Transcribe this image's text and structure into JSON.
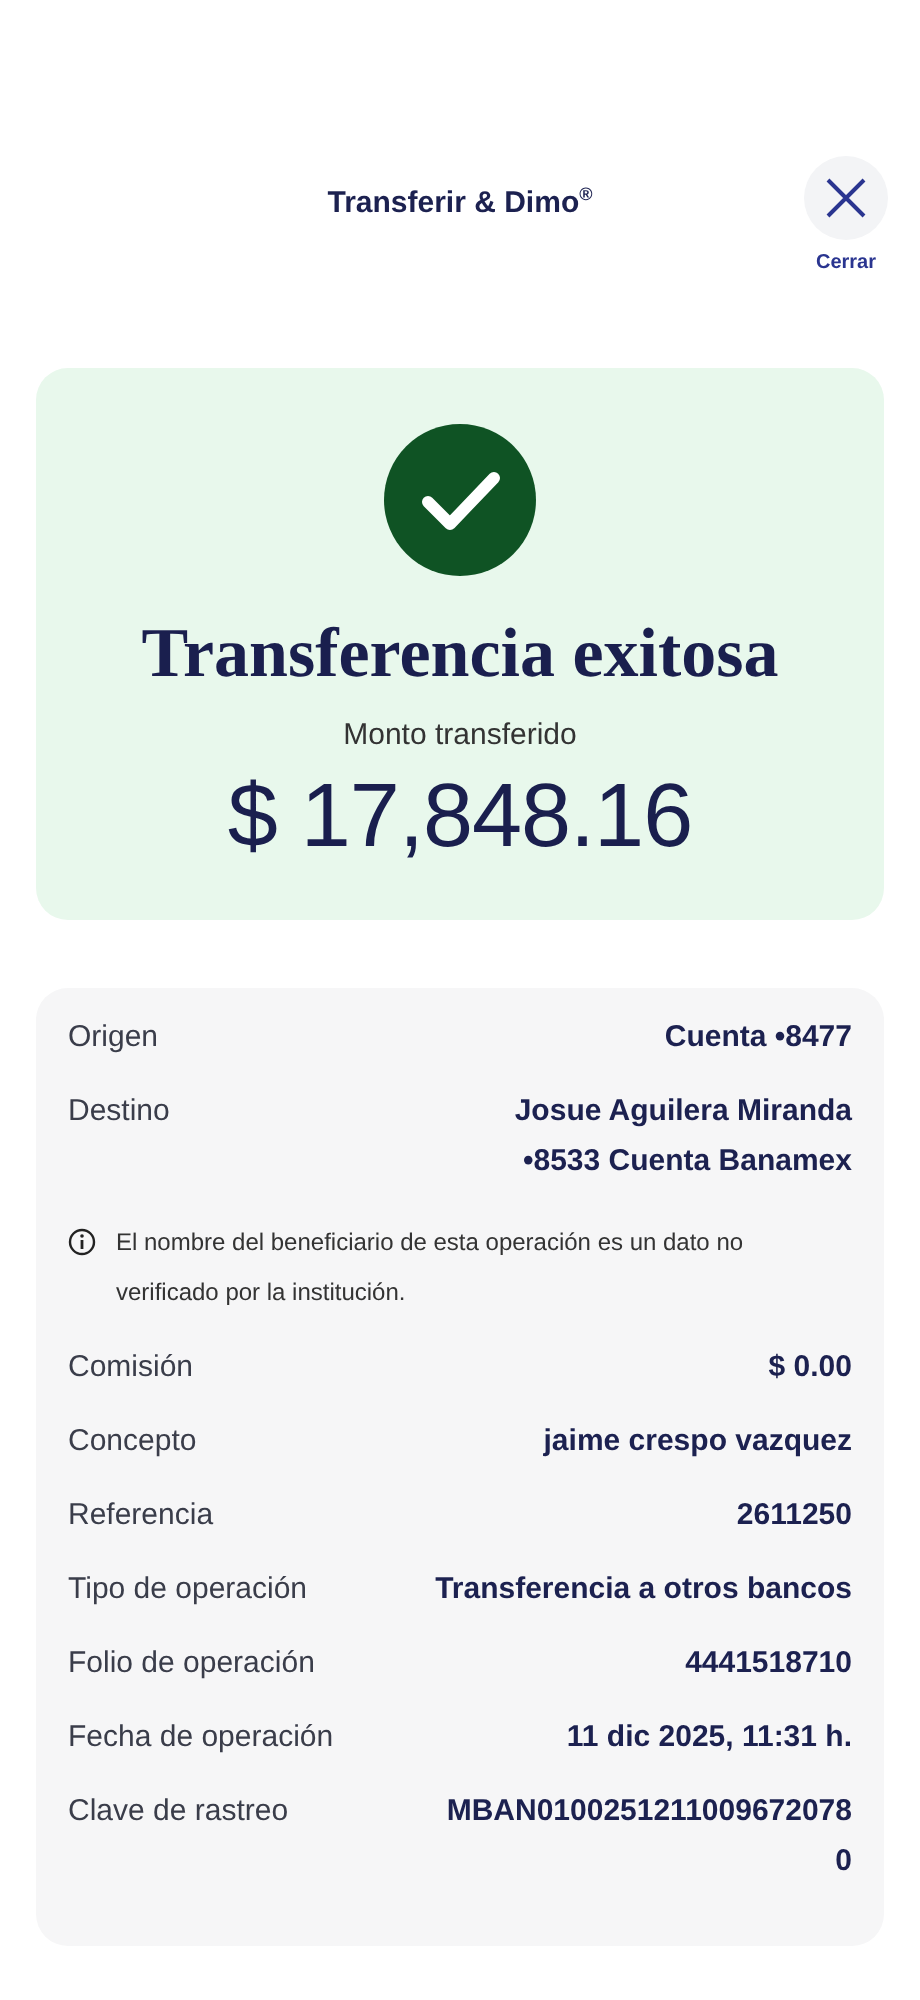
{
  "header": {
    "title": "Transferir & Dimo$^{®}$",
    "close_label": "Cerrar"
  },
  "result": {
    "title": "Transferencia exitosa",
    "amount_label": "Monto transferido",
    "amount": "$ 17,848.16"
  },
  "details": [
    {
      "kind": "row",
      "label": "Origen",
      "value_lines": [
        "Cuenta •8477"
      ]
    },
    {
      "kind": "row",
      "label": "Destino",
      "value_lines": [
        "Josue Aguilera Miranda",
        "•8533 Cuenta Banamex"
      ]
    },
    {
      "kind": "note",
      "text": "El nombre del beneficiario de esta operación es un dato no verificado por la institución."
    },
    {
      "kind": "row",
      "label": "Comisión",
      "value_lines": [
        "$ 0.00"
      ]
    },
    {
      "kind": "row",
      "label": "Concepto",
      "value_lines": [
        "jaime crespo vazquez"
      ]
    },
    {
      "kind": "row",
      "label": "Referencia",
      "value_lines": [
        "2611250"
      ]
    },
    {
      "kind": "row",
      "label": "Tipo de operación",
      "value_lines": [
        "Transferencia a otros bancos"
      ]
    },
    {
      "kind": "row",
      "label": "Folio de operación",
      "value_lines": [
        "4441518710"
      ]
    },
    {
      "kind": "row",
      "label": "Fecha de operación",
      "value_lines": [
        "11 dic 2025, 11:31 h."
      ]
    },
    {
      "kind": "wrap",
      "label": "Clave de rastreo",
      "value": "MBAN01002512110096720780"
    }
  ]
}
